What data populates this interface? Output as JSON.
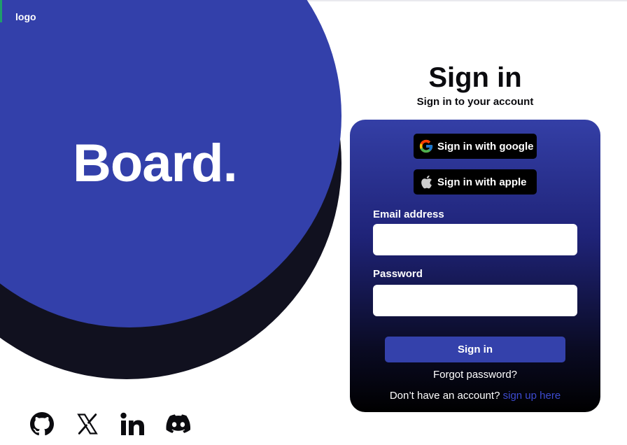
{
  "hero": {
    "logo_text": "logo",
    "brand_text": "Board."
  },
  "socials": [
    {
      "icon": "github-icon"
    },
    {
      "icon": "x-icon"
    },
    {
      "icon": "linkedin-icon"
    },
    {
      "icon": "discord-icon"
    }
  ],
  "signin": {
    "title": "Sign in",
    "subtitle": "Sign in to your account",
    "google_label": "Sign in with google",
    "apple_label": "Sign in with apple",
    "email_label": "Email address",
    "email_value": "",
    "password_label": "Password",
    "password_value": "",
    "submit_label": "Sign in",
    "forgot_label": "Forgot password?",
    "signup_prompt": "Don’t have an account?",
    "signup_link": "sign up here"
  },
  "colors": {
    "brand_blue": "#3340aa",
    "shadow_navy": "#11111f",
    "card_top": "#343fa6",
    "card_bottom": "#000000",
    "link_blue": "#3d4bd0"
  }
}
